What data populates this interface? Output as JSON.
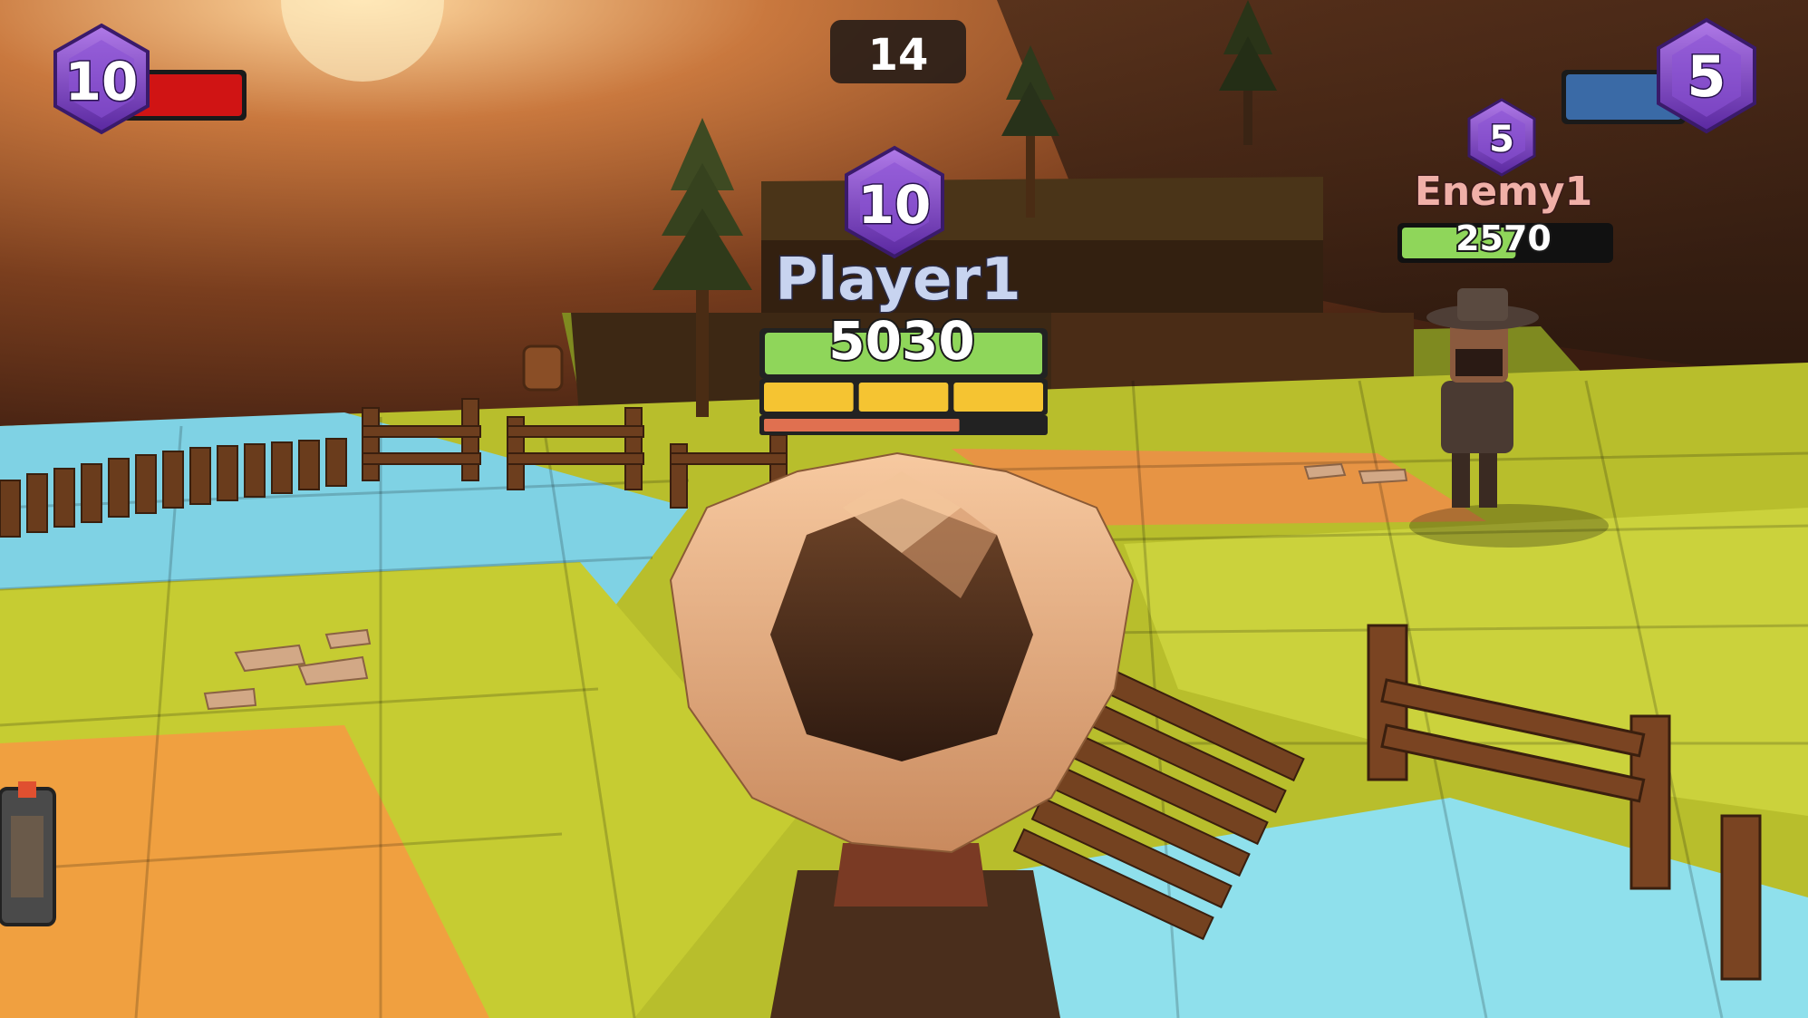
{
  "hud": {
    "timer": "14",
    "left_team": {
      "level": "10",
      "bar_color": "#d01414",
      "bar_fill": 1.0
    },
    "right_team": {
      "level": "5",
      "bar_color": "#3a6aa6",
      "bar_fill": 1.0
    }
  },
  "player": {
    "level": "10",
    "name": "Player1",
    "score": "5030",
    "health_fill": 1.0,
    "health_color": "#8fd65a",
    "ammo_segments": 3,
    "ammo_color": "#f5c432",
    "reload_fill": 0.7,
    "reload_color": "#e07050"
  },
  "enemy": {
    "level": "5",
    "name": "Enemy1",
    "score": "2570",
    "health_fill": 0.55,
    "health_color": "#8fd65a"
  },
  "colors": {
    "level_gem": "#7a3fc0",
    "level_gem_dark": "#4a1f86",
    "tile_green": "#c8cc34",
    "tile_blue": "#7fd6e8",
    "tile_orange": "#f0a040",
    "wood": "#6a3c1c"
  },
  "icons": [
    "level-gem-icon",
    "tree-icon",
    "fence-icon",
    "cowboy-hat-icon"
  ]
}
